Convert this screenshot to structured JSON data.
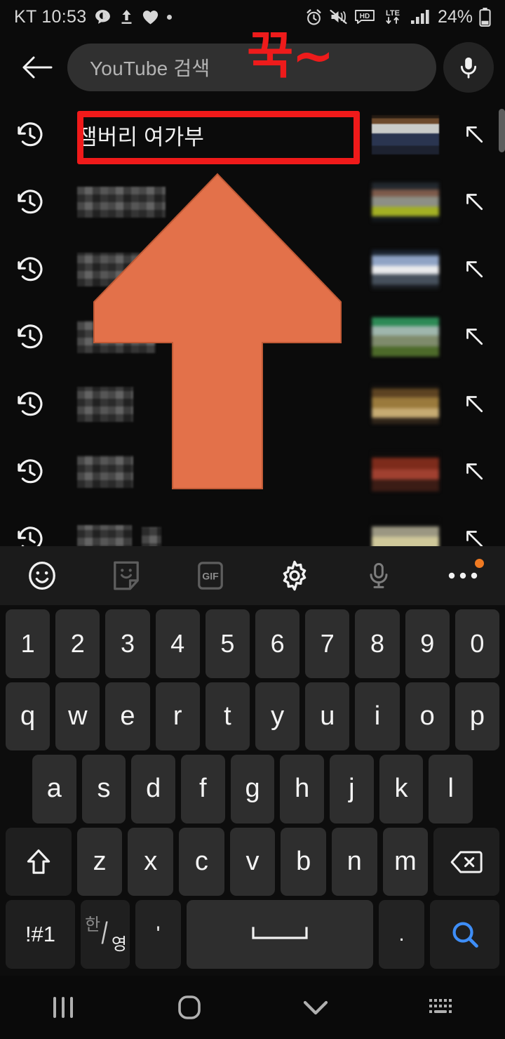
{
  "status_bar": {
    "carrier_and_time": "KT 10:53",
    "battery_percent": "24%",
    "left_icons": [
      "kakaotalk-icon",
      "upload-icon",
      "heart-icon",
      "dot-icon"
    ],
    "right_icons": [
      "alarm-icon",
      "mute-vibrate-icon",
      "hd-icon",
      "lte-data-icon",
      "signal-bars-icon",
      "battery-icon"
    ]
  },
  "search": {
    "back_icon": "back-arrow-icon",
    "placeholder": "YouTube 검색",
    "value": "",
    "mic_icon": "microphone-icon"
  },
  "annotations": {
    "press_and_hold_text": "꾹~",
    "press_and_hold_color": "#ee1b1b",
    "highlight_box_color": "#f01a1a",
    "arrow_color": "#e3714a",
    "arrow_direction": "up"
  },
  "suggestions": {
    "history_icon": "history-clock-icon",
    "insert_icon": "arrow-up-left-insert-icon",
    "items": [
      {
        "label": "잼버리 여가부",
        "censored": false,
        "highlighted": true,
        "thumbnail": "politician-at-desk"
      },
      {
        "label": "",
        "censored": true,
        "highlighted": false,
        "thumbnail": "censored-thumb-2"
      },
      {
        "label": "",
        "censored": true,
        "highlighted": false,
        "thumbnail": "censored-thumb-3"
      },
      {
        "label": "",
        "censored": true,
        "highlighted": false,
        "thumbnail": "censored-thumb-4"
      },
      {
        "label": "",
        "censored": true,
        "highlighted": false,
        "thumbnail": "censored-thumb-5"
      },
      {
        "label": "",
        "censored": true,
        "highlighted": false,
        "thumbnail": "censored-thumb-6"
      },
      {
        "label": "",
        "censored": true,
        "highlighted": false,
        "thumbnail": "censored-thumb-7"
      }
    ]
  },
  "keyboard_toolbar": {
    "items": [
      {
        "name": "emoji-icon",
        "label": ""
      },
      {
        "name": "sticker-icon",
        "label": ""
      },
      {
        "name": "gif-icon",
        "label": "GIF"
      },
      {
        "name": "gear-icon",
        "label": ""
      },
      {
        "name": "microphone-icon",
        "label": ""
      },
      {
        "name": "more-options-icon",
        "label": "",
        "badge": true
      }
    ]
  },
  "keyboard": {
    "row_numbers": [
      "1",
      "2",
      "3",
      "4",
      "5",
      "6",
      "7",
      "8",
      "9",
      "0"
    ],
    "row_top": [
      "q",
      "w",
      "e",
      "r",
      "t",
      "y",
      "u",
      "i",
      "o",
      "p"
    ],
    "row_home": [
      "a",
      "s",
      "d",
      "f",
      "g",
      "h",
      "j",
      "k",
      "l"
    ],
    "row_shift": {
      "shift_label": "shift-icon",
      "letters": [
        "z",
        "x",
        "c",
        "v",
        "b",
        "n",
        "m"
      ],
      "backspace_label": "backspace-icon"
    },
    "row_bottom": {
      "symbols_label": "!#1",
      "lang_han": "한",
      "lang_eng": "영",
      "quote_label": "'",
      "space_label": "space-icon",
      "period_label": ".",
      "search_label": "search-magnifier-icon",
      "search_color": "#3e8ef7"
    }
  },
  "nav_bar": {
    "items": [
      {
        "name": "recents-button",
        "label": ""
      },
      {
        "name": "home-button",
        "label": ""
      },
      {
        "name": "hide-keyboard-button",
        "label": ""
      },
      {
        "name": "switch-keyboard-button",
        "label": ""
      }
    ]
  }
}
